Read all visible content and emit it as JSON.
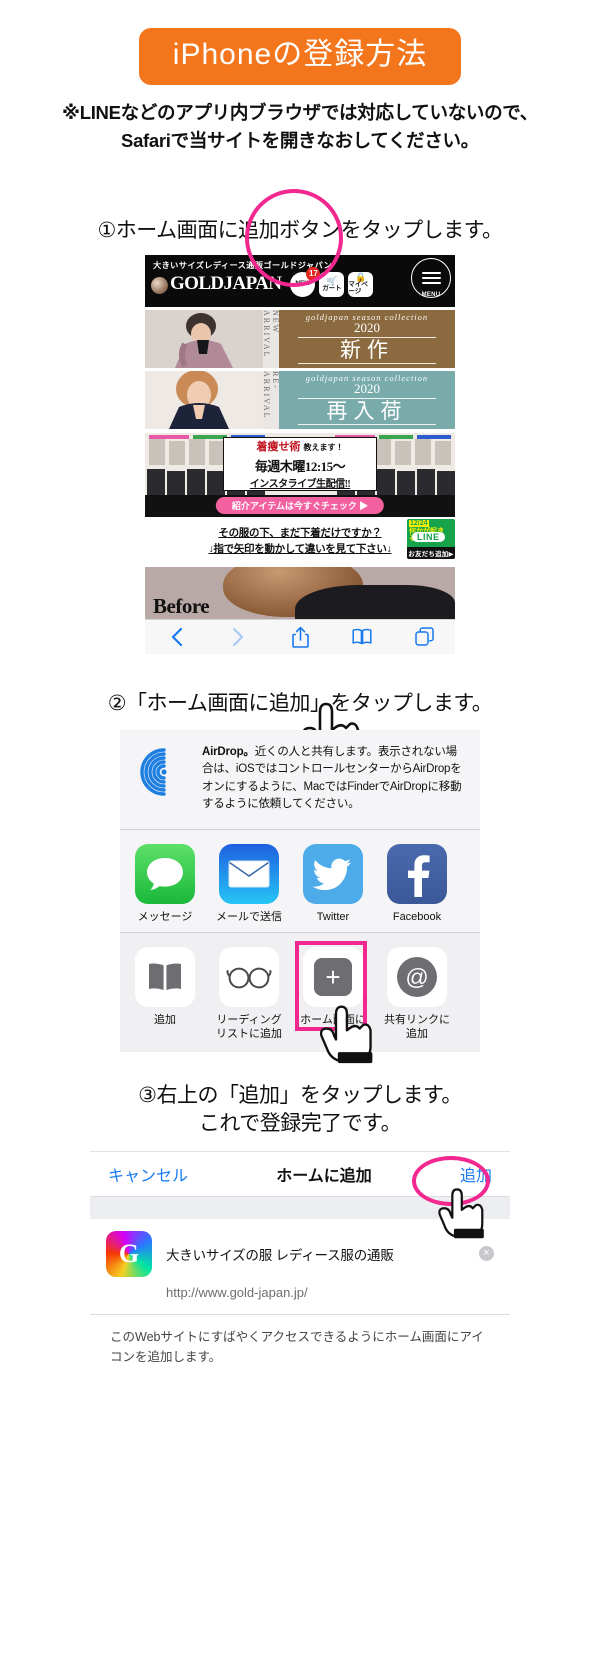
{
  "header": {
    "title": "iPhoneの登録方法",
    "title_bg": "#f4761c",
    "notice_line1": "※LINEなどのアプリ内ブラウザでは対応していないので、",
    "notice_line2": "Safariで当サイトを開きなおしてください。"
  },
  "steps": {
    "step1": "①ホーム画面に追加ボタンをタップします。",
    "step2": "②「ホーム画面に追加」をタップします。",
    "step3_line1": "③右上の「追加」をタップします。",
    "step3_line2": "これで登録完了です。"
  },
  "site": {
    "tagline": "大きいサイズレディース通販ゴールドジャパン",
    "logo": "GOLDJAPAN",
    "btn_new": "NEW",
    "badge_count": "17",
    "btn_cart": "カート",
    "btn_mypage": "マイページ",
    "menu_label": "MENU",
    "banners": [
      {
        "side": "NEW ARRIVAL",
        "en": "goldjapan season collection",
        "year": "2020",
        "jp": "新作",
        "color": "#8a6a3e"
      },
      {
        "side": "RE-ARRIVAL",
        "en": "goldjapan season collection",
        "year": "2020",
        "jp": "再入荷",
        "color": "#7aabab"
      }
    ],
    "insta": {
      "line1": "着痩せ術",
      "line1_sub": "教えます！",
      "line2": "毎週木曜12:15〜",
      "line3": "インスタライブ生配信!!",
      "cta": "紹介アイテムは今すぐチェック ▶"
    },
    "promo_line1": "その服の下、まだ下着だけですか？",
    "promo_line2": "↓指で矢印を動かして違いを見て下さい↓",
    "line_badge": {
      "date": "12/24",
      "catch": "何かが起きる…",
      "brand": "LINE",
      "cta": "お友だち追加▶"
    },
    "before_label": "Before"
  },
  "safari_toolbar": {
    "back": "back-arrow",
    "forward": "forward-arrow",
    "share": "share-icon",
    "bookmarks": "book-icon",
    "tabs": "tabs-icon"
  },
  "share_sheet": {
    "airdrop_bold": "AirDrop。",
    "airdrop_text": "近くの人と共有します。表示されない場合は、iOSではコントロールセンターからAirDropをオンにするように、MacではFinderでAirDropに移動するように依頼してください。",
    "apps": [
      {
        "label": "メッセージ",
        "icon": "messages-icon"
      },
      {
        "label": "メールで送信",
        "icon": "mail-icon"
      },
      {
        "label": "Twitter",
        "icon": "twitter-icon"
      },
      {
        "label": "Facebook",
        "icon": "facebook-icon"
      }
    ],
    "actions": [
      {
        "label": "追加",
        "icon": "book-icon",
        "highlighted": false
      },
      {
        "label": "リーディングリストに追加",
        "icon": "glasses-icon",
        "highlighted": false
      },
      {
        "label": "ホーム画面に追加",
        "icon": "plus-icon",
        "highlighted": true
      },
      {
        "label": "共有リンクに追加",
        "icon": "at-icon",
        "highlighted": false
      }
    ]
  },
  "add_to_home": {
    "cancel": "キャンセル",
    "title": "ホームに追加",
    "add": "追加",
    "app_letter": "G",
    "app_name": "大きいサイズの服 レディース服の通販",
    "url": "http://www.gold-japan.jp/",
    "description": "このWebサイトにすばやくアクセスできるようにホーム画面にアイコンを追加します。"
  },
  "accent": {
    "pink": "#f2278f",
    "link_blue": "#1779f0"
  }
}
